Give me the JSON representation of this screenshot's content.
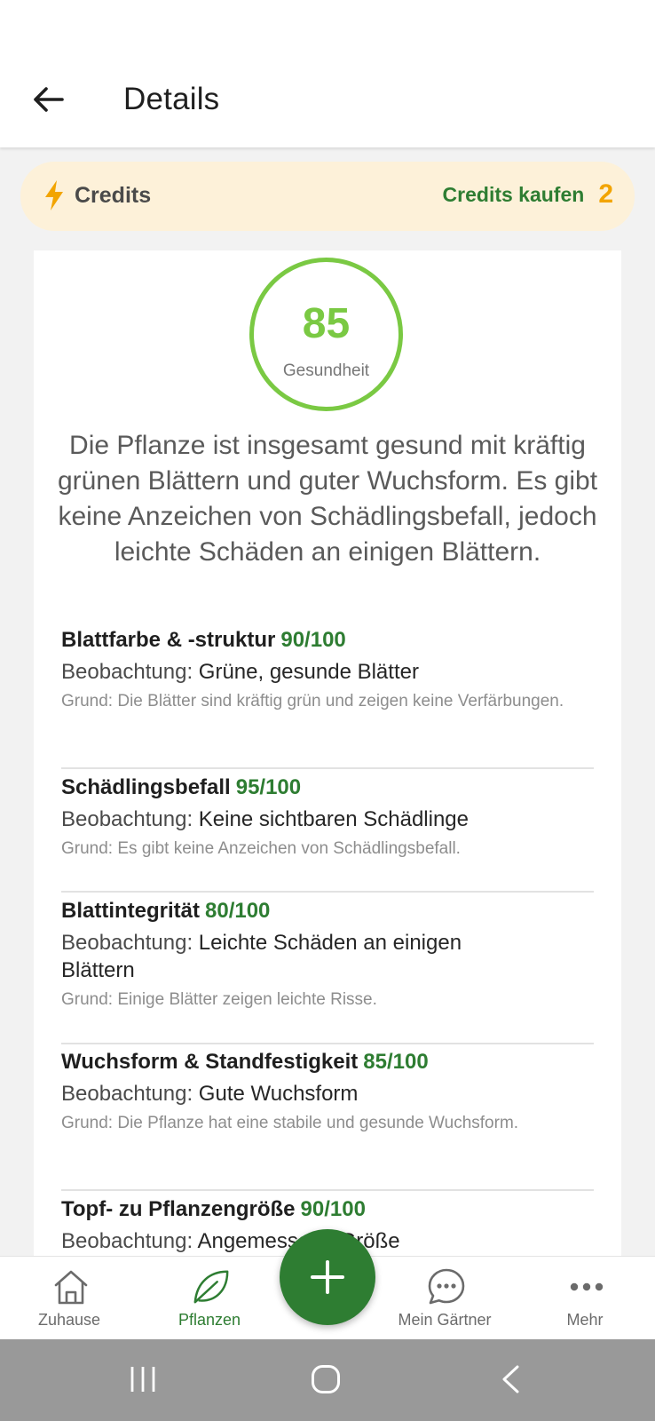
{
  "header": {
    "title": "Details"
  },
  "credits": {
    "label": "Credits",
    "buy_label": "Credits kaufen",
    "count": "2"
  },
  "health": {
    "score": "85",
    "score_label": "Gesundheit",
    "summary": "Die Pflanze ist insgesamt gesund mit kräftig grünen Blättern und guter Wuchsform. Es gibt keine Anzeichen von Schädlingsbefall, jedoch leichte Schäden an einigen Blättern."
  },
  "metrics": [
    {
      "title": "Blattfarbe & -struktur",
      "score": "90/100",
      "observation_label": "Beobachtung:",
      "observation": "Grüne, gesunde Blätter",
      "reason": "Grund: Die Blätter sind kräftig grün und zeigen keine Verfärbungen."
    },
    {
      "title": "Schädlingsbefall",
      "score": "95/100",
      "observation_label": "Beobachtung:",
      "observation": "Keine sichtbaren Schädlinge",
      "reason": "Grund: Es gibt keine Anzeichen von Schädlingsbefall."
    },
    {
      "title": "Blattintegrität",
      "score": "80/100",
      "observation_label": "Beobachtung:",
      "observation": "Leichte Schäden an einigen Blättern",
      "reason": "Grund: Einige Blätter zeigen leichte Risse."
    },
    {
      "title": "Wuchsform & Standfestigkeit",
      "score": "85/100",
      "observation_label": "Beobachtung:",
      "observation": "Gute Wuchsform",
      "reason": "Grund: Die Pflanze hat eine stabile und gesunde Wuchsform."
    },
    {
      "title": "Topf- zu Pflanzengröße",
      "score": "90/100",
      "observation_label": "Beobachtung:",
      "observation": "Angemessene Größe",
      "reason": ""
    }
  ],
  "nav": {
    "items": [
      {
        "label": "Zuhause",
        "icon": "home-icon",
        "active": false
      },
      {
        "label": "Pflanzen",
        "icon": "leaf-icon",
        "active": true
      },
      {
        "label": "Mein Gärtner",
        "icon": "chat-icon",
        "active": false
      },
      {
        "label": "Mehr",
        "icon": "more-icon",
        "active": false
      }
    ],
    "fab_icon": "plus-icon"
  },
  "colors": {
    "primary_green": "#2e7d32",
    "score_green": "#7ac943",
    "credits_bg": "#fdf1d9",
    "credits_accent": "#f2a400"
  }
}
